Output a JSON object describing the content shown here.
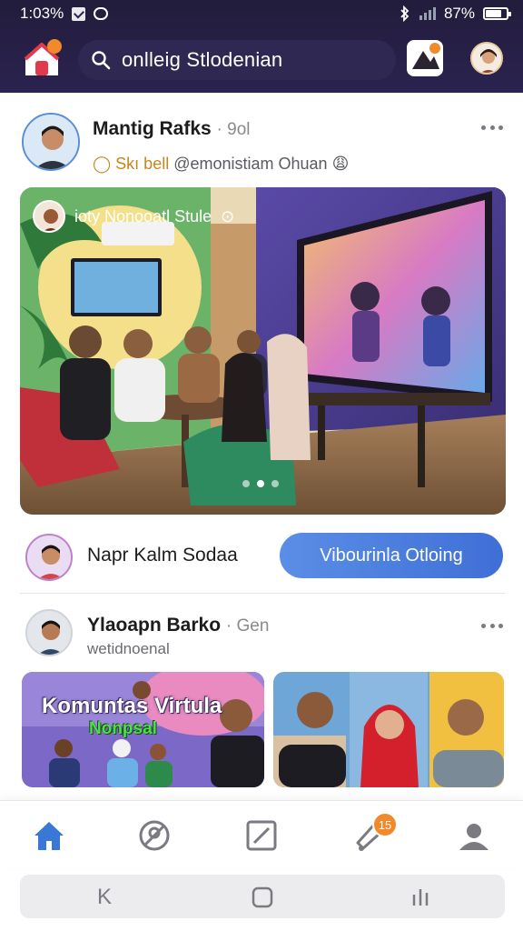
{
  "status_bar": {
    "time": "1:03%",
    "battery": "87%"
  },
  "header": {
    "search_placeholder": "onlleig Stlodenian"
  },
  "post1": {
    "author": "Mantig Rafks",
    "time": "9ol",
    "tag": "Skı bell",
    "subtitle": "@emonistiam Ohuan",
    "emoji": "😩",
    "media_chip_label": "ioty Nonooatl Stule",
    "carousel": {
      "count": 3,
      "active_index": 1
    },
    "commenter_name": "Napr Kalm Sodaa",
    "cta_label": "Vibourinla Otloing"
  },
  "post2": {
    "author": "Ylaoapn Barko",
    "time": "Gen",
    "subtitle": "wetidnoenal",
    "tile_title": "Komuntas Virtula",
    "tile_subtitle": "Nonpsal"
  },
  "tabbar": {
    "items": [
      {
        "icon": "home-icon",
        "active": true
      },
      {
        "icon": "explore-icon",
        "active": false
      },
      {
        "icon": "edit-icon",
        "active": false
      },
      {
        "icon": "notification-icon",
        "active": false
      },
      {
        "icon": "profile-icon",
        "active": false
      }
    ],
    "notification_badge": "15"
  },
  "system_nav": {
    "back": "K",
    "home": "home",
    "recents": "recents"
  },
  "colors": {
    "header_bg": "#221c3b",
    "accent": "#4a7be0",
    "badge": "#f28a2c"
  }
}
